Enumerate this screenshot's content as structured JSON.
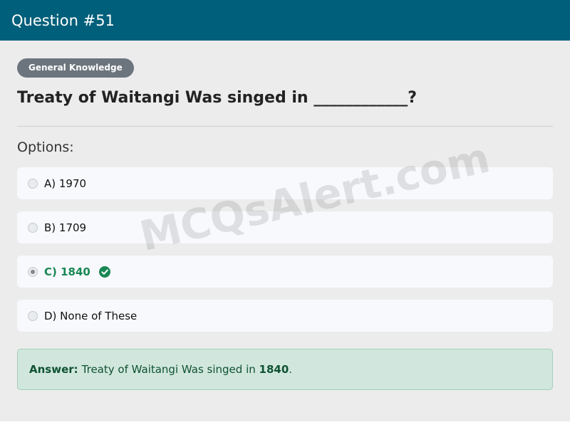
{
  "header": {
    "title": "Question #51"
  },
  "badge": "General Knowledge",
  "question": "Treaty of Waitangi Was singed in ____________?",
  "options_label": "Options:",
  "options": [
    {
      "label": "A) 1970"
    },
    {
      "label": "B) 1709"
    },
    {
      "label": "C) 1840",
      "selected": true,
      "correct": true
    },
    {
      "label": "D) None of These"
    }
  ],
  "answer": {
    "label": "Answer:",
    "text": "Treaty of Waitangi Was singed in",
    "value": "1840",
    "suffix": "."
  },
  "watermark": "MCQsAlert.com",
  "colors": {
    "header_bg": "#005f7a",
    "correct": "#198754",
    "answer_bg": "#d1e7dd"
  },
  "icons": {
    "correct": "check-circle-icon"
  }
}
